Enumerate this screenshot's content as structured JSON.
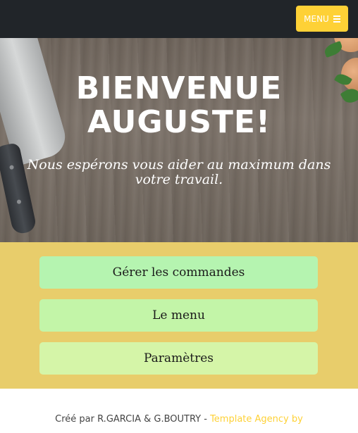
{
  "nav": {
    "menu_label": "MENU",
    "menu_icon": "bars-icon"
  },
  "hero": {
    "title_line1": "BIENVENUE",
    "title_line2": "AUGUSTE!",
    "subtitle": "Nous espérons vous aider au maximum dans votre travail."
  },
  "actions": {
    "items": [
      {
        "label": "Gérer les commandes",
        "color": "#b5f4b0"
      },
      {
        "label": "Le menu",
        "color": "#c3f5a8"
      },
      {
        "label": "Paramètres",
        "color": "#d5f5a8"
      }
    ],
    "background": "#e8cd6b"
  },
  "footer": {
    "credit_text": "Créé par R.GARCIA & G.BOUTRY - ",
    "link_text": "Template Agency by"
  },
  "colors": {
    "navbar": "#212529",
    "accent": "#fed136"
  }
}
